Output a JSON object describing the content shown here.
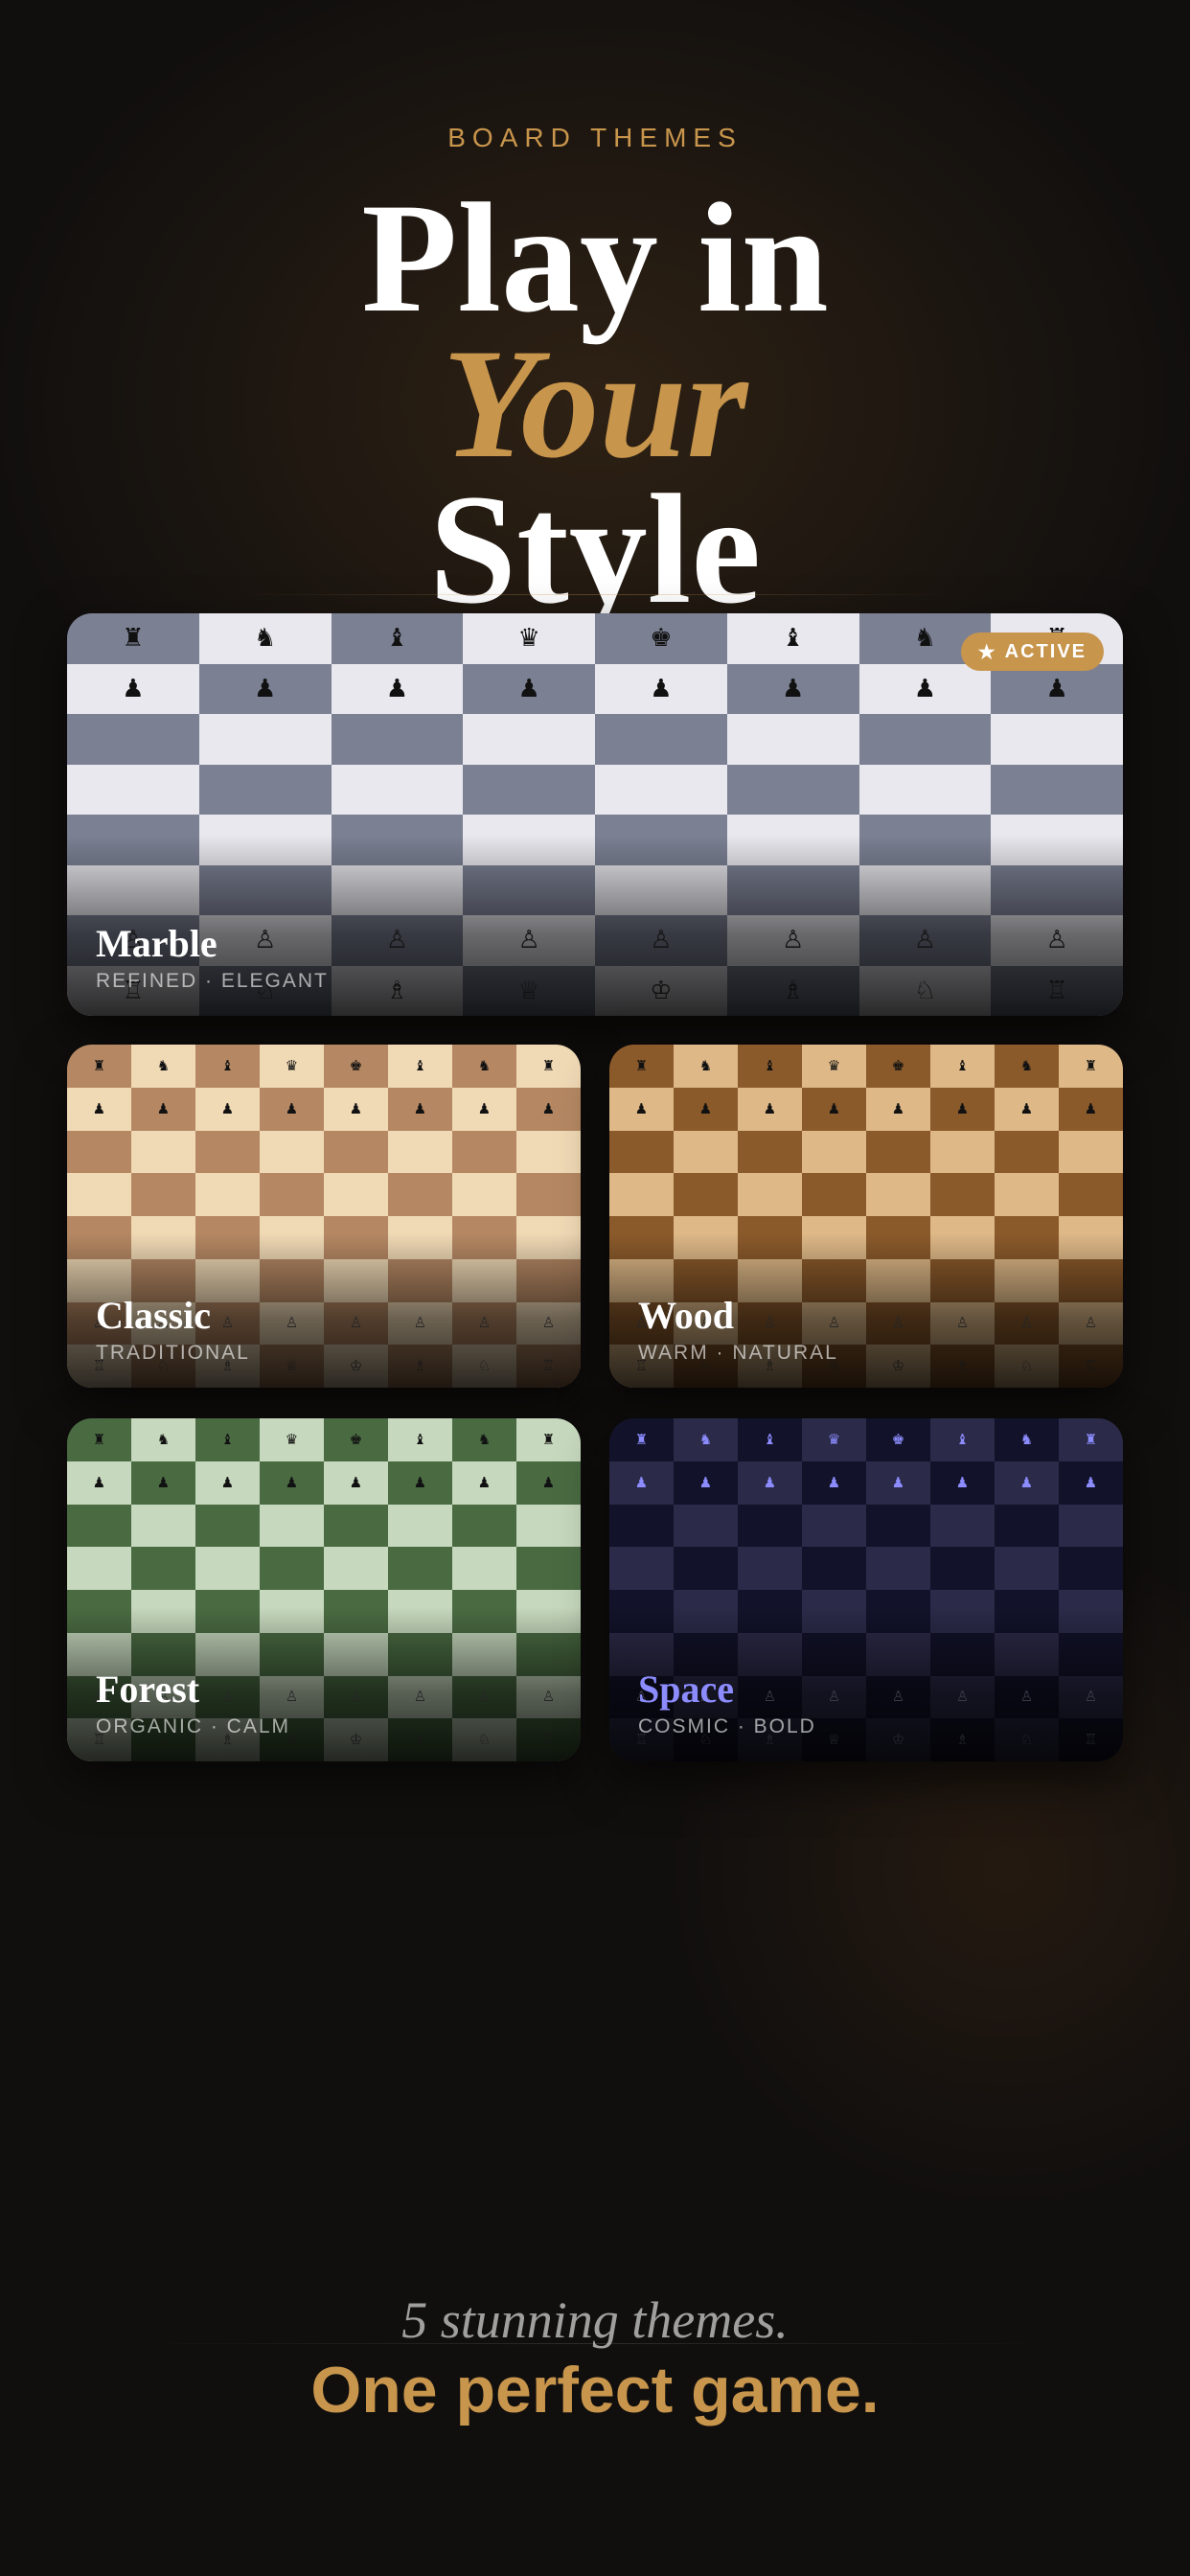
{
  "header": {
    "kicker": "BOARD THEMES",
    "title_line1": "Play in",
    "title_line2": "Your",
    "title_line3": "Style"
  },
  "active_badge": {
    "icon": "star-icon",
    "glyph": "★",
    "label": "ACTIVE"
  },
  "pieces": {
    "back_rank": [
      "♜",
      "♞",
      "♝",
      "♛",
      "♚",
      "♝",
      "♞",
      "♜"
    ],
    "pawn": "♟",
    "white_pawn": "♙",
    "white_back_rank": [
      "♖",
      "♘",
      "♗",
      "♕",
      "♔",
      "♗",
      "♘",
      "♖"
    ]
  },
  "themes": [
    {
      "id": "marble",
      "name": "Marble",
      "subtitle": "REFINED · ELEGANT",
      "light": "#e8e8ee",
      "dark": "#7b8093",
      "black_piece": "#111111",
      "white_piece": "#333333",
      "title_color": "#ffffff",
      "active": true
    },
    {
      "id": "classic",
      "name": "Classic",
      "subtitle": "TRADITIONAL",
      "light": "#f0d9b5",
      "dark": "#b58863",
      "black_piece": "#111111",
      "white_piece": "#555555",
      "title_color": "#ffffff",
      "active": false
    },
    {
      "id": "wood",
      "name": "Wood",
      "subtitle": "WARM · NATURAL",
      "light": "#deb887",
      "dark": "#8b5a2b",
      "black_piece": "#111111",
      "white_piece": "#555555",
      "title_color": "#ffffff",
      "active": false
    },
    {
      "id": "forest",
      "name": "Forest",
      "subtitle": "ORGANIC · CALM",
      "light": "#c6d8bd",
      "dark": "#4a6b42",
      "black_piece": "#111111",
      "white_piece": "#555555",
      "title_color": "#ffffff",
      "active": false
    },
    {
      "id": "space",
      "name": "Space",
      "subtitle": "COSMIC · BOLD",
      "light": "#2b2a48",
      "dark": "#12122a",
      "black_piece": "#8c8cff",
      "white_piece": "#8888aa",
      "title_color": "#8c8cff",
      "active": false
    }
  ],
  "footer": {
    "line1": "5 stunning themes.",
    "line2": "One perfect game."
  }
}
